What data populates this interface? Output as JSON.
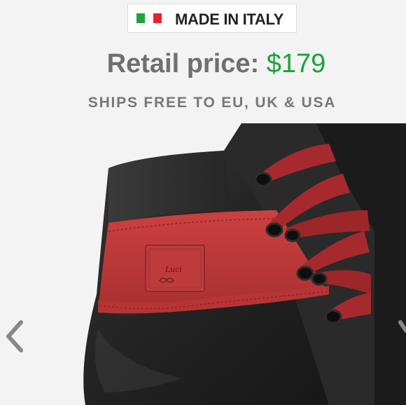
{
  "badge": {
    "text": "MADE IN ITALY",
    "flag_colors": [
      "#1fa43a",
      "#ffffff",
      "#e3262e"
    ]
  },
  "price": {
    "label": "Retail price:",
    "amount": "$179",
    "amount_color": "#1aa33a"
  },
  "shipping": {
    "text": "SHIPS FREE TO EU, UK & USA"
  },
  "product_image": {
    "subject": "black and red high-top sneaker close-up",
    "brand_tag": "Luci",
    "colors": {
      "leather": "#1f1f1f",
      "accent": "#c23a3a",
      "laces": "#a92b2e"
    }
  },
  "carousel": {
    "prev_icon": "chevron-left-icon",
    "next_icon": "chevron-right-icon"
  }
}
